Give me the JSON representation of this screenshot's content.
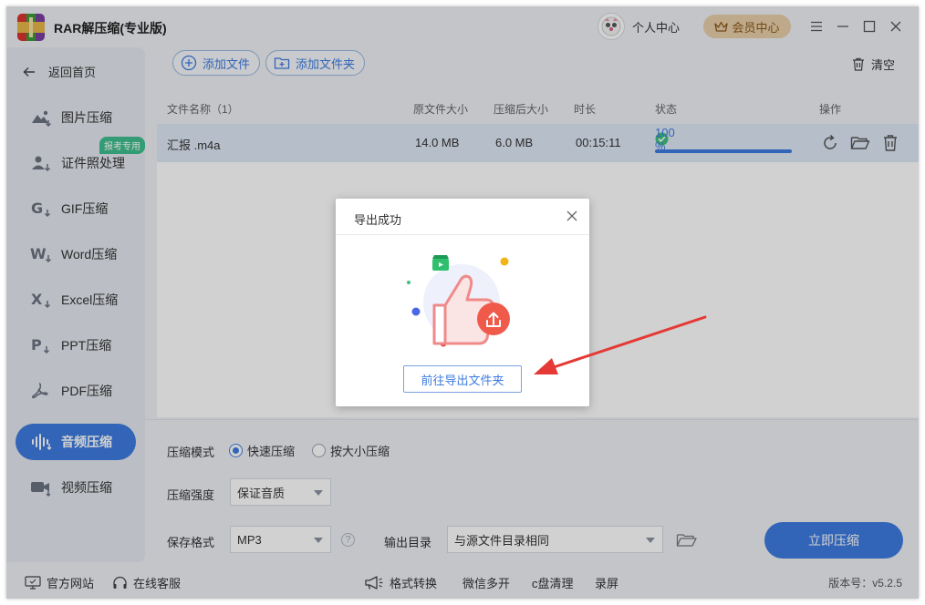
{
  "app": {
    "title": "RAR解压缩(专业版)"
  },
  "header": {
    "user_center": "个人中心",
    "member_center": "会员中心"
  },
  "sidebar": {
    "back": "返回首页",
    "badge": "报考专用",
    "items": [
      {
        "label": "图片压缩",
        "icon": "image-compress-icon"
      },
      {
        "label": "证件照处理",
        "icon": "id-photo-icon"
      },
      {
        "label": "GIF压缩",
        "icon": "gif-icon"
      },
      {
        "label": "Word压缩",
        "icon": "word-icon"
      },
      {
        "label": "Excel压缩",
        "icon": "excel-icon"
      },
      {
        "label": "PPT压缩",
        "icon": "ppt-icon"
      },
      {
        "label": "PDF压缩",
        "icon": "pdf-icon"
      },
      {
        "label": "音频压缩",
        "icon": "audio-icon",
        "active": true
      },
      {
        "label": "视频压缩",
        "icon": "video-icon"
      }
    ]
  },
  "toolbar": {
    "add_file": "添加文件",
    "add_folder": "添加文件夹",
    "clear": "清空"
  },
  "table": {
    "headers": {
      "name": "文件名称（1）",
      "orig_size": "原文件大小",
      "comp_size": "压缩后大小",
      "duration": "时长",
      "status": "状态",
      "ops": "操作"
    },
    "rows": [
      {
        "name": "汇报 .m4a",
        "orig_size": "14.0 MB",
        "comp_size": "6.0 MB",
        "duration": "00:15:11",
        "status": "100 %",
        "progress": 1.0
      }
    ]
  },
  "settings": {
    "mode_label": "压缩模式",
    "mode_fast": "快速压缩",
    "mode_size": "按大小压缩",
    "strength_label": "压缩强度",
    "strength_value": "保证音质",
    "format_label": "保存格式",
    "format_value": "MP3",
    "help": "?",
    "output_label": "输出目录",
    "output_value": "与源文件目录相同",
    "start": "立即压缩"
  },
  "footer": {
    "website": "官方网站",
    "service": "在线客服",
    "format_convert": "格式转换",
    "wechat": "微信多开",
    "c_clean": "c盘清理",
    "record": "录屏",
    "version": "版本号：v5.2.5"
  },
  "dialog": {
    "title": "导出成功",
    "button": "前往导出文件夹"
  },
  "colors": {
    "accent": "#3d7ce0",
    "member": "#e8cfa9",
    "arrow": "#e53935"
  }
}
